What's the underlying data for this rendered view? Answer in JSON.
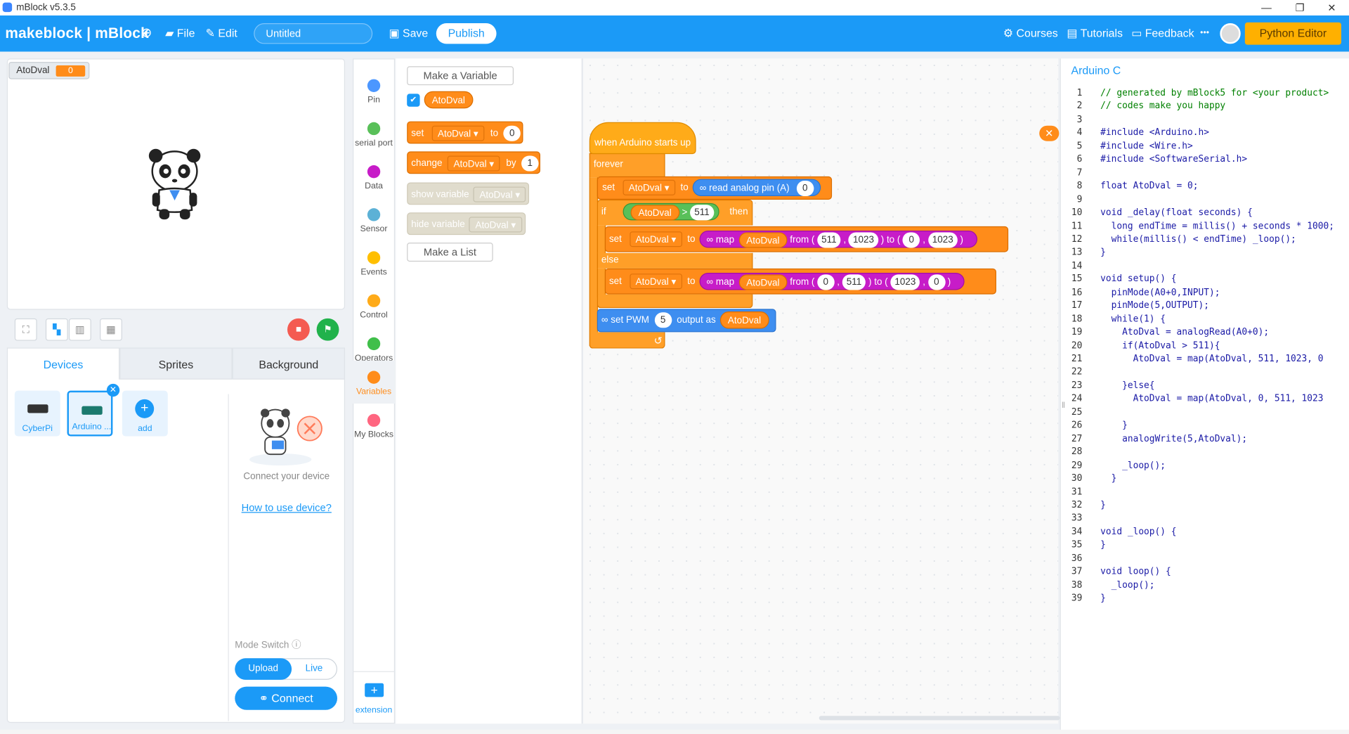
{
  "window": {
    "title": "mBlock v5.3.5",
    "min": "—",
    "max": "❐",
    "close": "✕"
  },
  "menu": {
    "brand": "makeblock | mBlock",
    "file": "File",
    "edit": "Edit",
    "project_title": "Untitled",
    "save": "Save",
    "publish": "Publish",
    "courses": "Courses",
    "tutorials": "Tutorials",
    "feedback": "Feedback",
    "more": "•••",
    "python_editor": "Python Editor"
  },
  "stage": {
    "var_name": "AtoDval",
    "var_value": "0"
  },
  "devices": {
    "tabs": [
      "Devices",
      "Sprites",
      "Background"
    ],
    "items": [
      {
        "label": "CyberPi"
      },
      {
        "label": "Arduino ..."
      },
      {
        "label": "add"
      }
    ],
    "connect_text": "Connect your device",
    "howto": "How to use device?",
    "mode_switch": "Mode Switch",
    "upload": "Upload",
    "live": "Live",
    "connect": "Connect"
  },
  "categories": [
    {
      "label": "Pin",
      "color": "#4c97ff"
    },
    {
      "label": "serial port",
      "color": "#59c059"
    },
    {
      "label": "Data",
      "color": "#c71cc8"
    },
    {
      "label": "Sensor",
      "color": "#5cb1d6"
    },
    {
      "label": "Events",
      "color": "#ffbf00"
    },
    {
      "label": "Control",
      "color": "#ffab19"
    },
    {
      "label": "Operators",
      "color": "#40bf4a"
    },
    {
      "label": "Variables",
      "color": "#ff8c1a"
    },
    {
      "label": "My Blocks",
      "color": "#ff6680"
    }
  ],
  "extension": "extension",
  "palette": {
    "make_variable": "Make a Variable",
    "var_reporter": "AtoDval",
    "set": "set",
    "set_var": "AtoDval",
    "to": "to",
    "set_val": "0",
    "change": "change",
    "change_var": "AtoDval",
    "by": "by",
    "change_val": "1",
    "show_variable": "show variable",
    "show_var": "AtoDval",
    "hide_variable": "hide variable",
    "hide_var": "AtoDval",
    "make_list": "Make a List"
  },
  "script": {
    "hat": "when Arduino starts up",
    "forever": "forever",
    "set1": {
      "set": "set",
      "var": "AtoDval",
      "to": "to",
      "read": "read analog pin  (A)",
      "pin": "0"
    },
    "if": {
      "if": "if",
      "var": "AtoDval",
      "op": ">",
      "val": "511",
      "then": "then"
    },
    "set2": {
      "set": "set",
      "var": "AtoDval",
      "to": "to",
      "map": "map",
      "mvar": "AtoDval",
      "from": "from",
      "a": "511",
      "b": "1023",
      "to2": "to",
      "c": "0",
      "d": "1023"
    },
    "else": "else",
    "set3": {
      "set": "set",
      "var": "AtoDval",
      "to": "to",
      "map": "map",
      "mvar": "AtoDval",
      "from": "from",
      "a": "0",
      "b": "511",
      "to2": "to",
      "c": "1023",
      "d": "0"
    },
    "pwm": {
      "label": "set PWM",
      "pin": "5",
      "output": "output as",
      "var": "AtoDval"
    }
  },
  "code": {
    "title": "Arduino C",
    "lines": [
      "// generated by mBlock5 for <your product>",
      "// codes make you happy",
      "",
      "#include <Arduino.h>",
      "#include <Wire.h>",
      "#include <SoftwareSerial.h>",
      "",
      "float AtoDval = 0;",
      "",
      "void _delay(float seconds) {",
      "  long endTime = millis() + seconds * 1000;",
      "  while(millis() < endTime) _loop();",
      "}",
      "",
      "void setup() {",
      "  pinMode(A0+0,INPUT);",
      "  pinMode(5,OUTPUT);",
      "  while(1) {",
      "    AtoDval = analogRead(A0+0);",
      "    if(AtoDval > 511){",
      "      AtoDval = map(AtoDval, 511, 1023, 0",
      "",
      "    }else{",
      "      AtoDval = map(AtoDval, 0, 511, 1023",
      "",
      "    }",
      "    analogWrite(5,AtoDval);",
      "",
      "    _loop();",
      "  }",
      "",
      "}",
      "",
      "void _loop() {",
      "}",
      "",
      "void loop() {",
      "  _loop();",
      "}"
    ]
  }
}
